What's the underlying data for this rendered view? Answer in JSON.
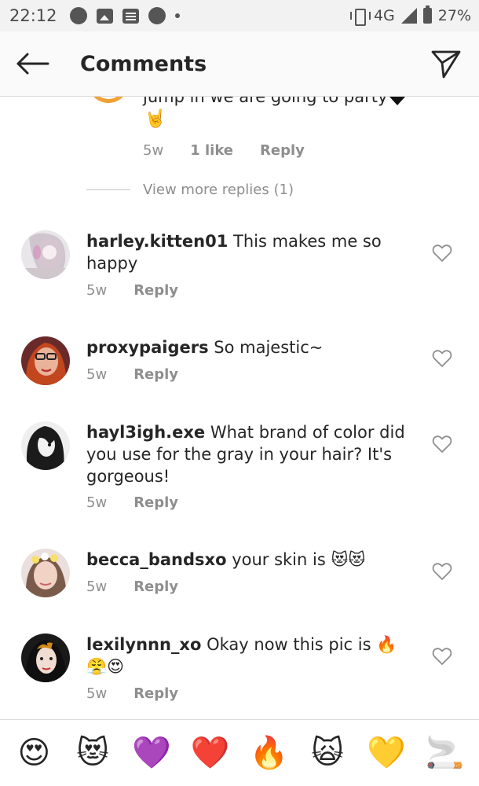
{
  "status_bar": {
    "time": "22:12",
    "network": "4G",
    "battery": "27%"
  },
  "header": {
    "title": "Comments"
  },
  "partial_reply": {
    "text": "jump in we are going to party",
    "time": "5w",
    "likes": "1 like",
    "reply": "Reply"
  },
  "view_more": {
    "label": "View more replies (1)"
  },
  "comments": [
    {
      "username": "harley.kitten01",
      "text": "This makes me so happy",
      "time": "5w",
      "reply": "Reply"
    },
    {
      "username": "proxypaigers",
      "text": "So majestic~",
      "time": "5w",
      "reply": "Reply"
    },
    {
      "username": "hayl3igh.exe",
      "text": "What brand of color did you use for the gray in your hair? It's gorgeous!",
      "time": "5w",
      "reply": "Reply"
    },
    {
      "username": "becca_bandsxo",
      "text": "your skin is 😻😻",
      "time": "5w",
      "reply": "Reply"
    },
    {
      "username": "lexilynnn_xo",
      "text": "Okay now this pic is 🔥😤😍",
      "time": "5w",
      "reply": "Reply"
    }
  ],
  "emoji_bar": [
    {
      "name": "heart-eyes-emoji",
      "glyph": "😍"
    },
    {
      "name": "heart-eyes-cat-emoji",
      "glyph": "😻"
    },
    {
      "name": "purple-heart-emoji",
      "glyph": "💜"
    },
    {
      "name": "red-heart-emoji",
      "glyph": "❤️"
    },
    {
      "name": "fire-emoji",
      "glyph": "🔥"
    },
    {
      "name": "weary-cat-emoji",
      "glyph": "🙀"
    },
    {
      "name": "yellow-heart-emoji",
      "glyph": "💛"
    },
    {
      "name": "cigarette-emoji",
      "glyph": "🚬"
    }
  ],
  "colors": {
    "text_primary": "#262626",
    "text_secondary": "#8e8e8e",
    "divider": "#dbdbdb",
    "header_bg": "#fafafa",
    "status_bg": "#f2f2f2"
  }
}
